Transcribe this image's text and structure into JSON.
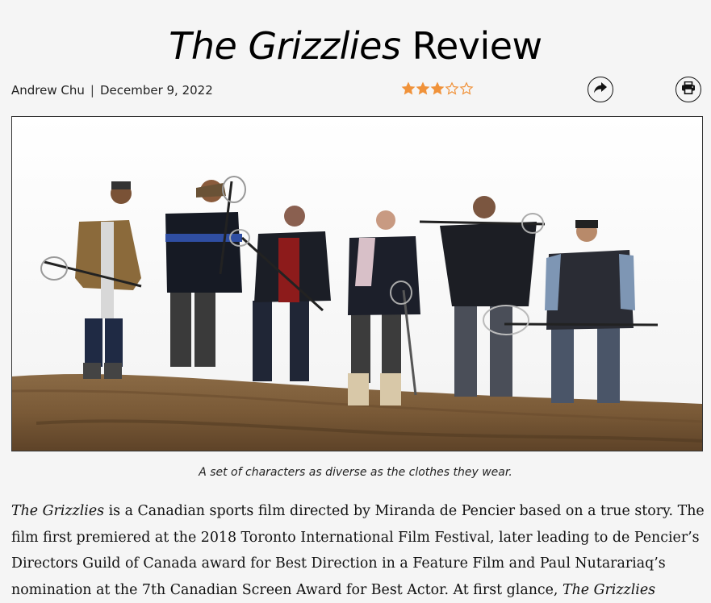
{
  "article": {
    "title_italic": "The Grizzlies",
    "title_rest": " Review",
    "author": "Andrew Chu",
    "separator": "|",
    "date": "December 9, 2022",
    "rating": {
      "filled": 3,
      "total": 5,
      "color": "#f0923a"
    },
    "photo_caption": "A set of characters as diverse as the clothes they wear.",
    "body": {
      "film_title": "The Grizzlies",
      "line1_rest": " is a Canadian sports film directed by Miranda de Pencier based on a true story. The",
      "line2": "film first premiered at the 2018 Toronto International Film Festival, later leading to de Pencier’s",
      "line3": "Directors Guild of Canada award for Best Direction in a Feature Film and Paul Nutarariaq’s",
      "line4_start": "nomination at the 7th Canadian Screen Award for Best Actor. At first glance, ",
      "line4_title": "The Grizzlies"
    }
  },
  "actions": {
    "share_icon": "share-icon",
    "print_icon": "printer-icon"
  }
}
